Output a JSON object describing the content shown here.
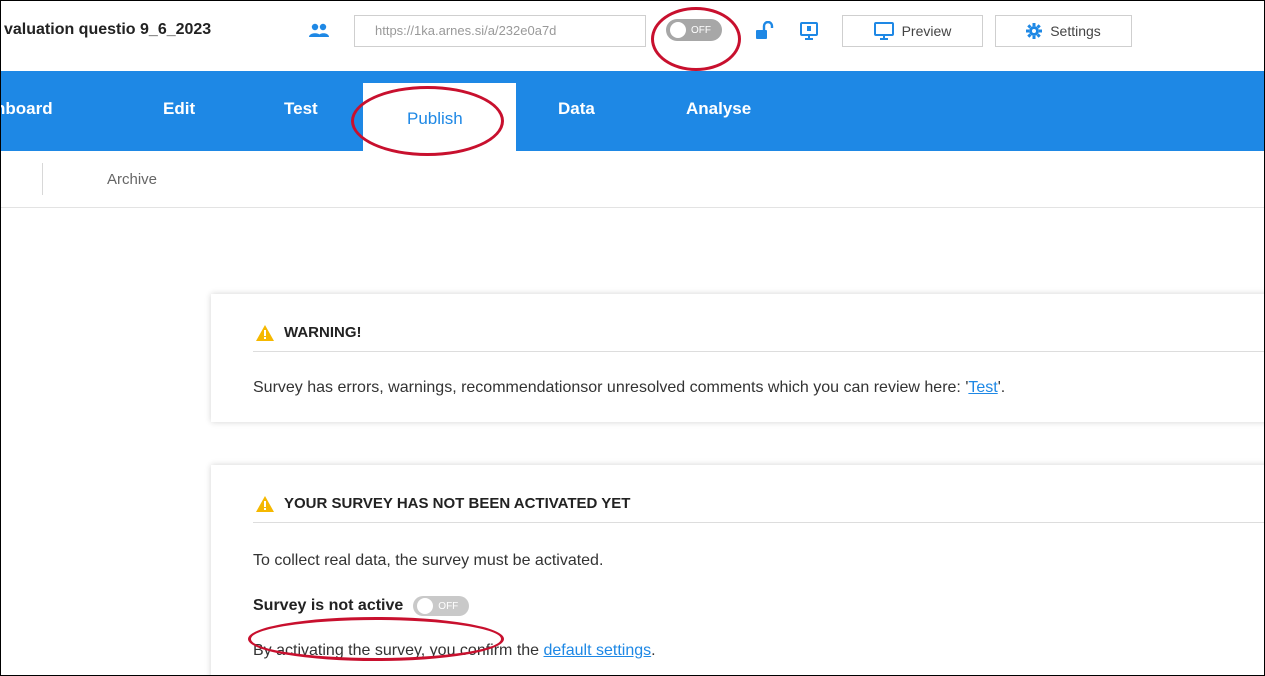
{
  "header": {
    "survey_title": "valuation questio 9_6_2023",
    "url": "https://1ka.arnes.si/a/232e0a7d",
    "toggle_label": "OFF",
    "preview_label": "Preview",
    "settings_label": "Settings"
  },
  "nav": {
    "items": [
      "hboard",
      "Edit",
      "Test",
      "Publish",
      "Data",
      "Analyse"
    ],
    "active": "Publish"
  },
  "subnav": {
    "archive": "Archive"
  },
  "warning_card": {
    "title": "WARNING!",
    "text_before": "Survey has errors, warnings, recommendationsor unresolved comments which you can review here: '",
    "link": "Test",
    "text_after": "'."
  },
  "activation_card": {
    "title": "YOUR SURVEY HAS NOT BEEN ACTIVATED YET",
    "info": "To collect real data, the survey must be activated.",
    "status_label": "Survey is not active",
    "toggle_label": "OFF",
    "confirm_before": "By activating the survey, you confirm the ",
    "confirm_link": "default settings",
    "confirm_after": "."
  },
  "colors": {
    "brand": "#1e88e5",
    "annotation": "#c8102e",
    "warning": "#f5b800"
  },
  "icons": [
    "users-icon",
    "unlock-icon",
    "display-icon",
    "monitor-icon",
    "gear-icon",
    "warning-icon"
  ]
}
